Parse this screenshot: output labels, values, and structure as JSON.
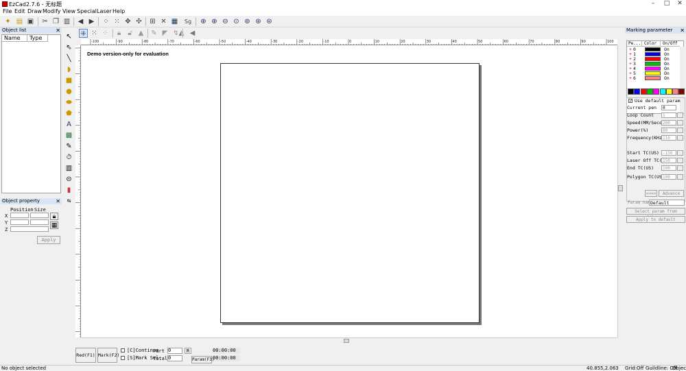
{
  "window": {
    "title": "EzCad2.7.6 - 无标题",
    "min": "–",
    "max": "□",
    "close": "✕"
  },
  "menu": [
    "File",
    "Edit",
    "Draw",
    "Modify",
    "View",
    "Special",
    "Laser",
    "Help"
  ],
  "object_list": {
    "title": "Object list",
    "col_name": "Name",
    "col_type": "Type"
  },
  "object_property": {
    "title": "Object property",
    "position": "Position",
    "size": "Size",
    "x": "X",
    "y": "Y",
    "z": "Z",
    "apply": "Apply"
  },
  "canvas": {
    "watermark": "Demo version-only for evaluation"
  },
  "ruler": {
    "top_labels": [
      "-100",
      "-90",
      "-80",
      "-70",
      "-60",
      "-50",
      "-40",
      "-30",
      "-20",
      "-10",
      "0",
      "10",
      "20",
      "30",
      "40",
      "50",
      "60",
      "70",
      "80",
      "90",
      "100"
    ]
  },
  "bottom": {
    "red_btn": "Red(F1)",
    "mark_btn": "Mark(F2)",
    "continue": "[C]Continue",
    "mark_sel": "[S]Mark Sel",
    "part_label": "Part",
    "part_value": "0",
    "r_btn": "R",
    "total_label": "Total",
    "total_value": "0",
    "time1": "00:00:00",
    "time2": "00:00:00",
    "param_btn": "Param(F3)"
  },
  "status": {
    "left": "No object selected",
    "coords": "40.855,2.063",
    "grid": "Grid:Off",
    "guideline": "Guildline: Off",
    "object": "Object:O"
  },
  "marking": {
    "title": "Marking parameter",
    "cols": [
      "Pe...",
      "Color",
      "On/Off"
    ],
    "pens": [
      {
        "n": "0",
        "color": "#000000",
        "state": "On"
      },
      {
        "n": "1",
        "color": "#0000ff",
        "state": "On"
      },
      {
        "n": "2",
        "color": "#ff0000",
        "state": "On"
      },
      {
        "n": "3",
        "color": "#00c000",
        "state": "On"
      },
      {
        "n": "4",
        "color": "#ff00ff",
        "state": "On"
      },
      {
        "n": "5",
        "color": "#ffff00",
        "state": "On"
      },
      {
        "n": "6",
        "color": "#ff8080",
        "state": "On"
      }
    ],
    "palette": [
      "#000000",
      "#0000ff",
      "#ff0000",
      "#00c000",
      "#ff00ff",
      "#00ffff",
      "#ffff00",
      "#ff8080",
      "#800000"
    ],
    "use_default": "Use default param",
    "params": [
      {
        "label": "Current pen",
        "value": "0"
      },
      {
        "label": "Loop Count",
        "value": "1"
      },
      {
        "label": "Speed(MM/Second",
        "value": "200"
      },
      {
        "label": "Power(%)",
        "value": "80"
      },
      {
        "label": "Frequency(KHz)",
        "value": "110"
      },
      {
        "label": "Start TC(US)",
        "value": "-150"
      },
      {
        "label": "Laser Off TC(US",
        "value": "150"
      },
      {
        "label": "End TC(US)",
        "value": "100"
      },
      {
        "label": "Polygon TC(US)",
        "value": "100"
      }
    ],
    "more_btn": "<<<<",
    "advance_btn": "Advance",
    "param_name_label": "Param name",
    "param_name_value": "Default",
    "select_lib_btn": "Select param from library",
    "apply_default_btn": "Apply to default"
  }
}
